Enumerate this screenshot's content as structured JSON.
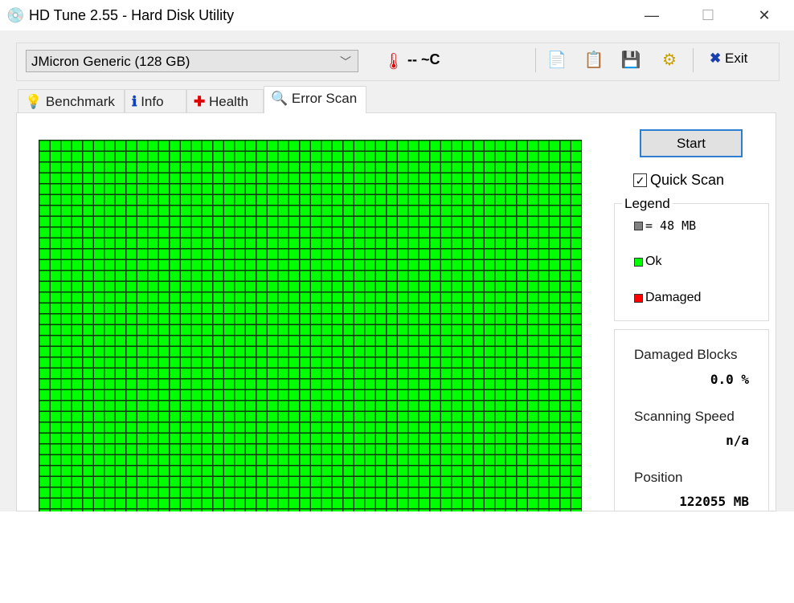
{
  "window": {
    "title": "HD Tune 2.55 - Hard Disk Utility",
    "minimize": "—",
    "maximize": "☐",
    "close": "✕"
  },
  "toolbar": {
    "drive": "JMicron Generic (128 GB)",
    "temperature": "-- ~C",
    "exit_label": "Exit",
    "icons": [
      "copy-text-icon",
      "copy-screenshot-icon",
      "save-icon",
      "options-icon"
    ]
  },
  "tabs": [
    {
      "label": "Benchmark",
      "icon": "bulb-icon"
    },
    {
      "label": "Info",
      "icon": "info-icon"
    },
    {
      "label": "Health",
      "icon": "health-cross-icon"
    },
    {
      "label": "Error Scan",
      "icon": "magnifier-icon",
      "active": true
    }
  ],
  "scan": {
    "start_label": "Start",
    "quick_scan_label": "Quick Scan",
    "quick_scan_checked": true,
    "block_status": "all ok",
    "ok_color": "#00ff00"
  },
  "legend": {
    "title": "Legend",
    "block_size": "= 48 MB",
    "ok": "Ok",
    "damaged": "Damaged",
    "colors": {
      "block": "#808080",
      "ok": "#00ff00",
      "damaged": "#ff0000"
    }
  },
  "stats": {
    "damaged_label": "Damaged Blocks",
    "damaged_value": "0.0 %",
    "speed_label": "Scanning Speed",
    "speed_value": "n/a",
    "position_label": "Position",
    "position_value": "122055 MB"
  }
}
